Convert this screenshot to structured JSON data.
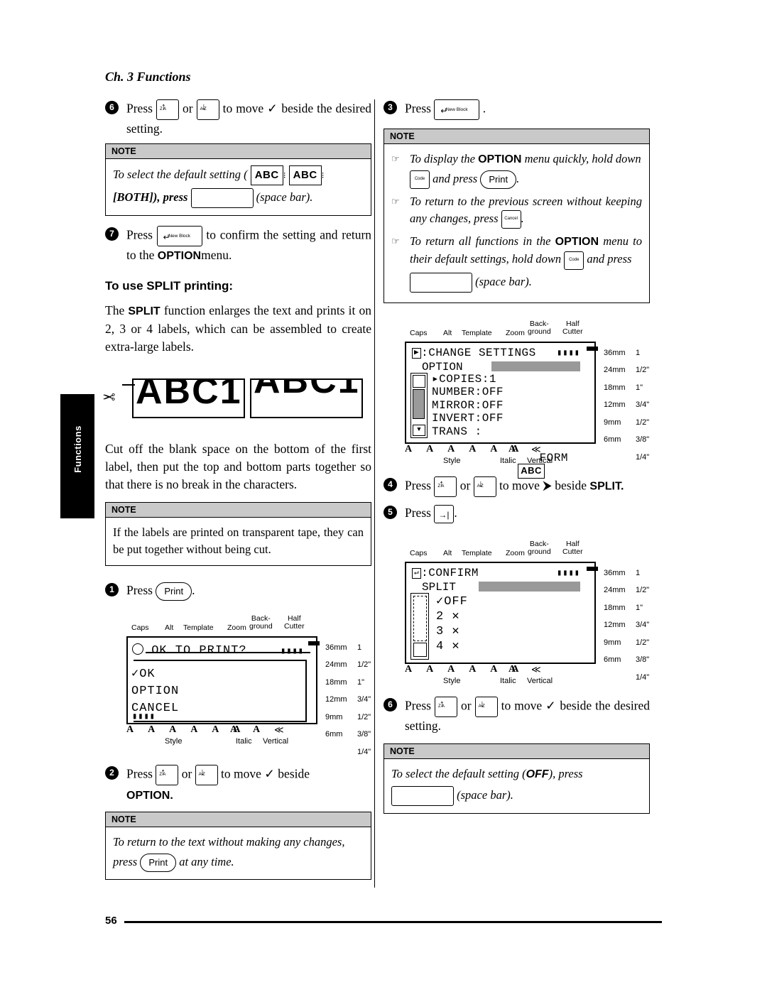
{
  "page": {
    "chapter": "Ch. 3 Functions",
    "side_tab": "Functions",
    "page_number": "56"
  },
  "left_column": {
    "step6": {
      "num": "6",
      "text_a": "Press",
      "key_up": {
        "arrow": "↑",
        "label": "Z·A"
      },
      "text_or": "or",
      "key_down": {
        "arrow": "↓",
        "label": "A·Z"
      },
      "text_b": "to move ✓ beside the desired setting."
    },
    "note1": {
      "header": "NOTE",
      "line1": "To select the default setting (",
      "abc1": "ABC",
      "abc2": "ABC",
      "line2": "[BOTH]), press",
      "line3": "(space bar)."
    },
    "step7": {
      "num": "7",
      "text_a": "Press",
      "key": {
        "glyph": "↵",
        "label": "New Block"
      },
      "text_b": "to confirm the setting and return to the",
      "bold": "OPTION",
      "text_c": "menu."
    },
    "heading_split": "To use SPLIT printing:",
    "split_para": {
      "a": "The ",
      "bold": "SPLIT",
      "b": " function enlarges the text and prints it on 2, 3 or 4 labels, which can be assembled to create extra-large labels."
    },
    "split_art": {
      "left_text": "ABC1",
      "right_text": "ABC1",
      "scissors": "✂"
    },
    "cut_para": "Cut off the blank space on the bottom of the first label, then put the top and bottom parts together so that there is no break in the characters.",
    "note2": {
      "header": "NOTE",
      "body": "If the labels are printed on transparent tape, they can be put together without being cut."
    },
    "step1": {
      "num": "1",
      "text_a": "Press",
      "key_label": "Print",
      "text_b": "."
    },
    "lcd1": {
      "top_labels": [
        "Caps",
        "Alt",
        "Template",
        "Zoom",
        "Back-\nground",
        "Half\nCutter"
      ],
      "screen_lines": [
        "OK TO PRINT?",
        "✓OK",
        " OPTION",
        " CANCEL"
      ],
      "sizes": [
        "36mm",
        "24mm",
        "18mm",
        "12mm",
        "9mm",
        "6mm"
      ],
      "widths": [
        "1 1/2\"",
        "1\"",
        "3/4\"",
        "1/2\"",
        "3/8\"",
        "1/4\""
      ],
      "bottom_labels": [
        "Style",
        "Italic",
        "Vertical"
      ],
      "font_row": "A A A A A A A        A      ≪"
    },
    "step2": {
      "num": "2",
      "text_a": "Press",
      "key_up": {
        "arrow": "↑",
        "label": "Z·A"
      },
      "text_or": "or",
      "key_down": {
        "arrow": "↓",
        "label": "A·Z"
      },
      "text_b": "to move ✓ beside",
      "bold": "OPTION."
    },
    "note3": {
      "header": "NOTE",
      "line1": "To return to the text without making any changes,",
      "line2_a": "press",
      "key_label": "Print",
      "line2_b": "at any time."
    }
  },
  "right_column": {
    "step3": {
      "num": "3",
      "text_a": "Press",
      "key": {
        "glyph": "↵",
        "label": "New Block"
      },
      "text_b": "."
    },
    "note4": {
      "header": "NOTE",
      "items": [
        {
          "marker": "☞",
          "a": "To display the ",
          "bold": "OPTION",
          "b": " menu quickly, hold down",
          "key1": "Code",
          "c": "and press",
          "key2": "Print",
          "d": "."
        },
        {
          "marker": "☞",
          "a": "To return to the previous screen without keeping any changes, press",
          "key1": "Cancel",
          "b": "."
        },
        {
          "marker": "☞",
          "a": "To return all functions in the ",
          "bold": "OPTION",
          "b": " menu to their default settings, hold down",
          "key1": "Code",
          "c": "and press",
          "d": "(space bar)."
        }
      ]
    },
    "lcd2": {
      "top_labels": [
        "Caps",
        "Alt",
        "Template",
        "Zoom",
        "Back-\nground",
        "Half\nCutter"
      ],
      "title_key": "▶",
      "title": ":CHANGE SETTINGS",
      "subtitle": "OPTION",
      "screen_lines": [
        "▸COPIES:1",
        " NUMBER:OFF",
        " MIRROR:OFF",
        " INVERT:OFF",
        " TRANS :",
        "   FORM"
      ],
      "form_value": "ABC",
      "sizes": [
        "36mm",
        "24mm",
        "18mm",
        "12mm",
        "9mm",
        "6mm"
      ],
      "widths": [
        "1 1/2\"",
        "1\"",
        "3/4\"",
        "1/2\"",
        "3/8\"",
        "1/4\""
      ],
      "bottom_labels": [
        "Style",
        "Italic",
        "Vertical"
      ]
    },
    "step4": {
      "num": "4",
      "text_a": "Press",
      "key_up": {
        "arrow": "↑",
        "label": "Z·A"
      },
      "text_or": "or",
      "key_down": {
        "arrow": "↓",
        "label": "A·Z"
      },
      "text_b": "to move ⮞ beside",
      "bold": "SPLIT."
    },
    "step5": {
      "num": "5",
      "text_a": "Press",
      "key": {
        "glyph": "→|"
      },
      "text_b": "."
    },
    "lcd3": {
      "top_labels": [
        "Caps",
        "Alt",
        "Template",
        "Zoom",
        "Back-\nground",
        "Half\nCutter"
      ],
      "title_key": "↵",
      "title": ":CONFIRM",
      "subtitle": "SPLIT",
      "screen_lines": [
        "✓OFF",
        "2 ✕",
        "3 ✕",
        "4 ✕"
      ],
      "sizes": [
        "36mm",
        "24mm",
        "18mm",
        "12mm",
        "9mm",
        "6mm"
      ],
      "widths": [
        "1 1/2\"",
        "1\"",
        "3/4\"",
        "1/2\"",
        "3/8\"",
        "1/4\""
      ],
      "bottom_labels": [
        "Style",
        "Italic",
        "Vertical"
      ]
    },
    "step6": {
      "num": "6",
      "text_a": "Press",
      "key_up": {
        "arrow": "↑",
        "label": "Z·A"
      },
      "text_or": "or",
      "key_down": {
        "arrow": "↓",
        "label": "A·Z"
      },
      "text_b": "to move ✓ beside the desired setting."
    },
    "note5": {
      "header": "NOTE",
      "line1_a": "To select the default setting (",
      "bold": "OFF",
      "line1_b": "), press",
      "line2": "(space bar)."
    }
  }
}
